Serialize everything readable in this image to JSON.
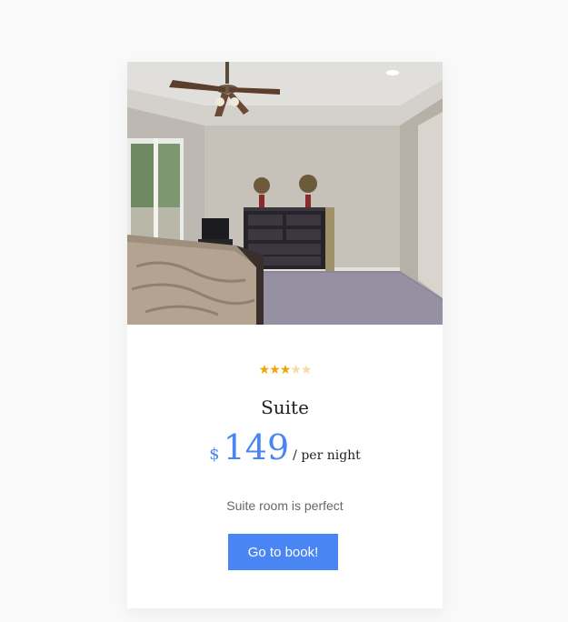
{
  "room": {
    "image_alt": "Bedroom with ceiling fan, bed and dresser",
    "rating": {
      "value": 3,
      "max": 5
    },
    "title": "Suite",
    "currency": "$",
    "price": "149",
    "unit": "/ per night",
    "description": "Suite room is perfect",
    "button_label": "Go to book!"
  },
  "colors": {
    "accent": "#4a86f3",
    "star_filled": "#f0a500",
    "star_empty": "#f6dca0",
    "background": "#f9f9f9"
  }
}
